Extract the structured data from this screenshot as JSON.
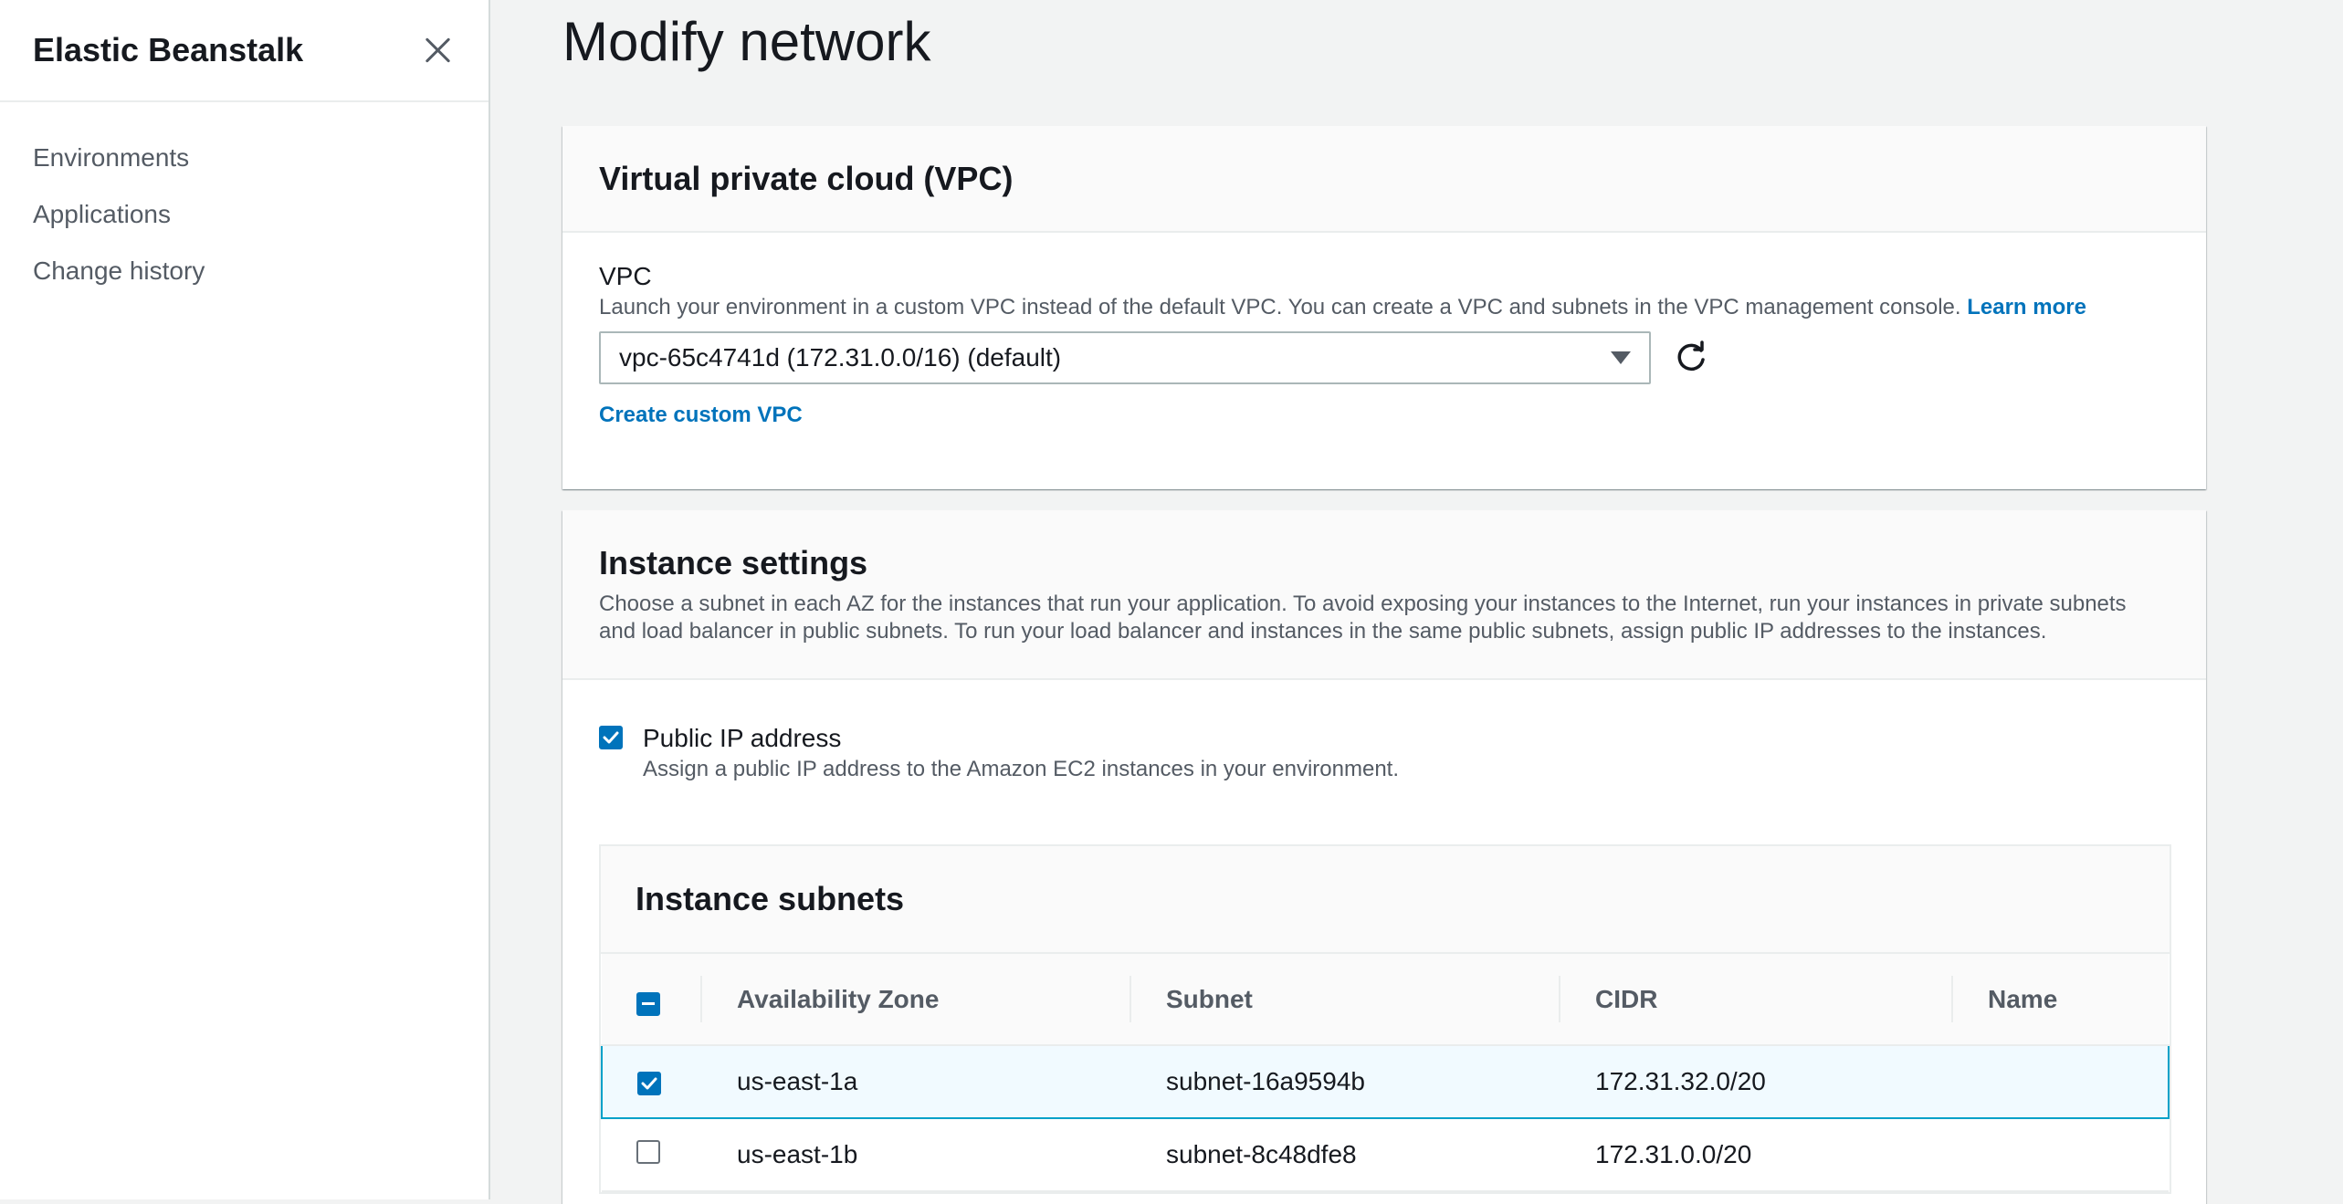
{
  "sidebar": {
    "title": "Elastic Beanstalk",
    "items": [
      {
        "label": "Environments"
      },
      {
        "label": "Applications"
      },
      {
        "label": "Change history"
      }
    ]
  },
  "page": {
    "title": "Modify network"
  },
  "vpc_section": {
    "title": "Virtual private cloud (VPC)",
    "field_label": "VPC",
    "field_description": "Launch your environment in a custom VPC instead of the default VPC. You can create a VPC and subnets in the VPC management console.",
    "learn_more": "Learn more",
    "selected_vpc": "vpc-65c4741d (172.31.0.0/16) (default)",
    "create_link": "Create custom VPC"
  },
  "instance_section": {
    "title": "Instance settings",
    "description_line1": "Choose a subnet in each AZ for the instances that run your application. To avoid exposing your instances to the Internet, run your instances in private subnets",
    "description_line2": "and load balancer in public subnets. To run your load balancer and instances in the same public subnets, assign public IP addresses to the instances.",
    "public_ip_label": "Public IP address",
    "public_ip_description": "Assign a public IP address to the Amazon EC2 instances in your environment.",
    "public_ip_checked": true
  },
  "subnets_table": {
    "title": "Instance subnets",
    "columns": [
      "Availability Zone",
      "Subnet",
      "CIDR",
      "Name"
    ],
    "rows": [
      {
        "zone": "us-east-1a",
        "subnet": "subnet-16a9594b",
        "cidr": "172.31.32.0/20",
        "name": "",
        "checked": true
      },
      {
        "zone": "us-east-1b",
        "subnet": "subnet-8c48dfe8",
        "cidr": "172.31.0.0/20",
        "name": "",
        "checked": false
      }
    ]
  },
  "colors": {
    "accent": "#0073bb",
    "selected_row_border": "#00a1c9",
    "selected_row_bg": "#f1faff"
  }
}
